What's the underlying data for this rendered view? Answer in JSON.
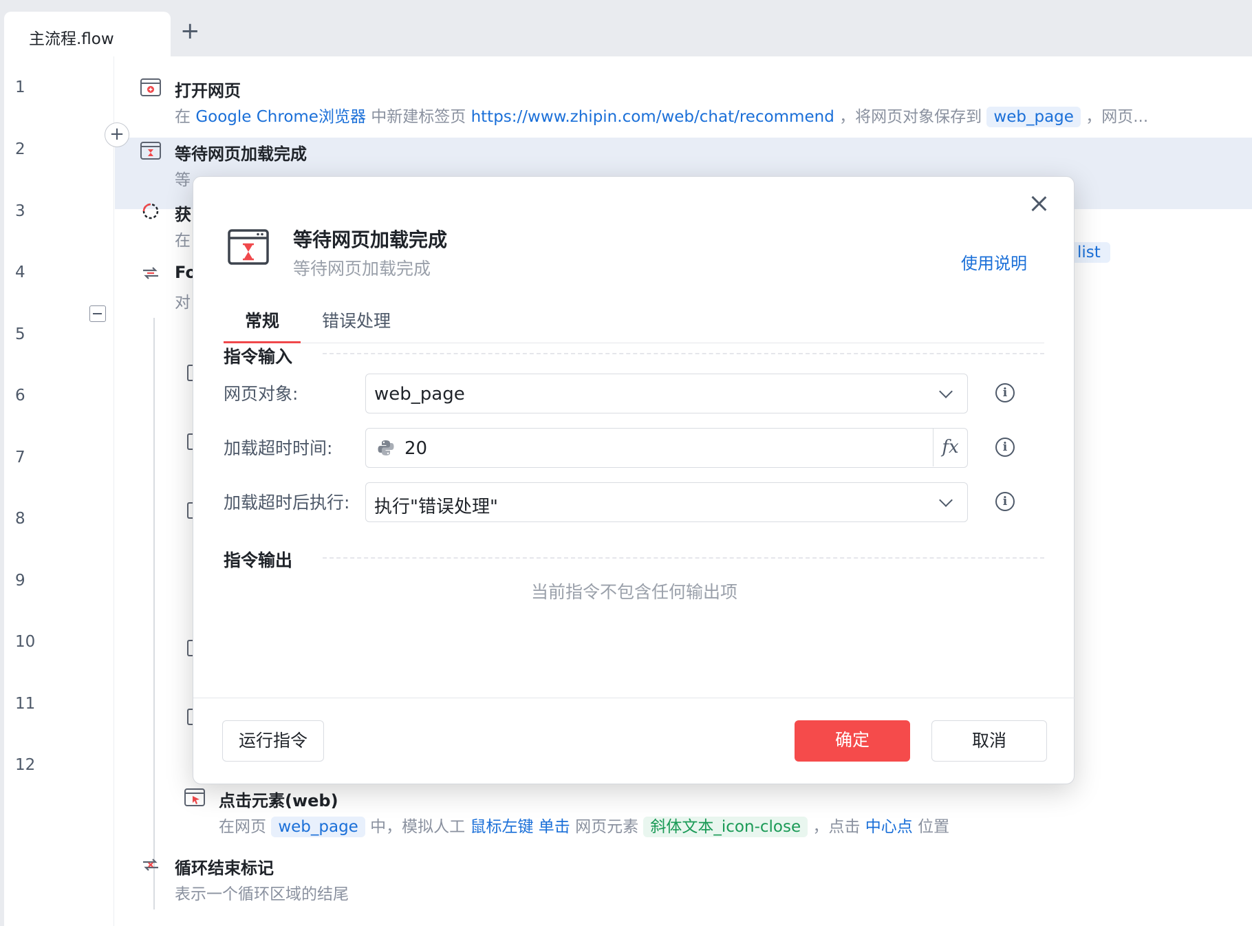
{
  "tabs": {
    "active_label": "主流程.flow",
    "add_symbol": "+"
  },
  "gutter": {
    "lines": [
      "1",
      "2",
      "3",
      "4",
      "5",
      "6",
      "7",
      "8",
      "9",
      "10",
      "11",
      "12"
    ]
  },
  "flow": {
    "step1": {
      "title": "打开网页",
      "desc_prefix": "在",
      "browser": "Google Chrome浏览器",
      "desc_mid": "中新建标签页",
      "url": "https://www.zhipin.com/web/chat/recommend",
      "desc_save": "，将网页对象保存到",
      "var": "web_page",
      "desc_tail": "，网页..."
    },
    "step2": {
      "title": "等待网页加载完成",
      "desc_partial": "等"
    },
    "step3": {
      "title_partial": "获",
      "desc_partial": "在",
      "chip_partial": "list"
    },
    "step4": {
      "title_partial": "Fo",
      "desc_partial": "对"
    },
    "step11": {
      "title": "点击元素(web)",
      "desc_prefix": "在网页",
      "var": "web_page",
      "desc_mid": "中，模拟人工",
      "mouse": "鼠标左键",
      "click": "单击",
      "desc_elem": "网页元素",
      "element": "斜体文本_icon-close",
      "desc_click": "，点击",
      "point": "中心点",
      "desc_tail": "位置"
    },
    "step12": {
      "title": "循环结束标记",
      "desc": "表示一个循环区域的结尾"
    }
  },
  "modal": {
    "title": "等待网页加载完成",
    "subtitle": "等待网页加载完成",
    "help_link": "使用说明",
    "tabs": [
      "常规",
      "错误处理"
    ],
    "input_section": "指令输入",
    "fields": [
      {
        "label": "网页对象:",
        "value": "web_page"
      },
      {
        "label": "加载超时时间:",
        "value": "20"
      },
      {
        "label": "加载超时后执行:",
        "value": "执行\"错误处理\""
      }
    ],
    "info_symbol": "i",
    "fx_symbol": "fx",
    "output_section": "指令输出",
    "output_empty": "当前指令不包含任何输出项",
    "buttons": {
      "run": "运行指令",
      "ok": "确定",
      "cancel": "取消"
    }
  },
  "colors": {
    "accent_red": "#f54b4b",
    "link_blue": "#1a6fd8",
    "chip_green": "#1a9a56",
    "highlight_row": "#e8edf6"
  }
}
